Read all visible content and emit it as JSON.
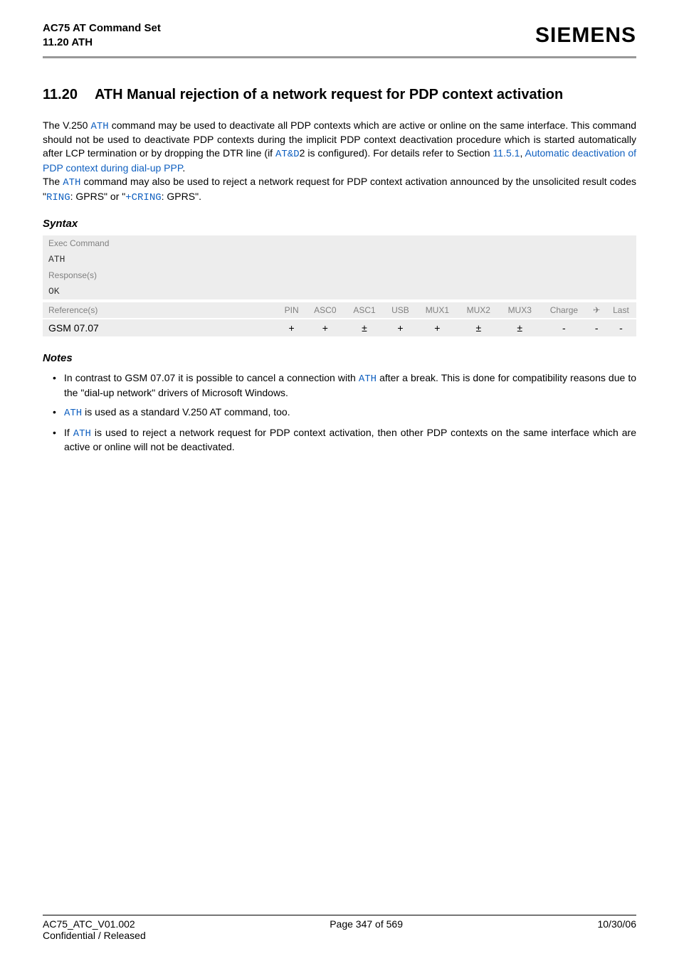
{
  "header": {
    "line1": "AC75 AT Command Set",
    "line2": "11.20 ATH",
    "logo": "SIEMENS"
  },
  "section": {
    "number": "11.20",
    "title": "ATH   Manual rejection of a network request for PDP context activation"
  },
  "paragraph": {
    "p1a": "The V.250 ",
    "p1b": "ATH",
    "p1c": " command may be used to deactivate all PDP contexts which are active or online on the same interface. This command should not be used to deactivate PDP contexts during the implicit PDP context deactivation procedure which is started automatically after LCP termination or by dropping the DTR line (if ",
    "p1d": "AT&D",
    "p1e": "2 is configured). For details refer to Section ",
    "p1f": "11.5.1",
    "p1g": ", ",
    "p1h": "Automatic deactivation of PDP context during dial-up PPP",
    "p1i": ".",
    "p2a": "The ",
    "p2b": "ATH",
    "p2c": " command may also be used to reject a network request for PDP context activation announced by the unsolicited result codes \"",
    "p2d": "RING",
    "p2e": ": GPRS\" or \"",
    "p2f": "+CRING",
    "p2g": ": GPRS\"."
  },
  "syntax": {
    "heading": "Syntax",
    "execLabel": "Exec Command",
    "execCmd": "ATH",
    "respLabel": "Response(s)",
    "respVal": "OK",
    "ref": {
      "label": "Reference(s)",
      "cols": [
        "PIN",
        "ASC0",
        "ASC1",
        "USB",
        "MUX1",
        "MUX2",
        "MUX3",
        "Charge",
        "",
        "Last"
      ],
      "airplane": "✈",
      "rowName": "GSM 07.07",
      "vals": [
        "+",
        "+",
        "±",
        "+",
        "+",
        "±",
        "±",
        "-",
        "-",
        "-"
      ]
    }
  },
  "notes": {
    "heading": "Notes",
    "n1a": "In contrast to GSM 07.07 it is possible to cancel a connection with ",
    "n1b": "ATH",
    "n1c": " after a break. This is done for compatibility reasons due to the \"dial-up network\" drivers of Microsoft Windows.",
    "n2a": "ATH",
    "n2b": " is used as a standard V.250 AT command, too.",
    "n3a": "If ",
    "n3b": "ATH",
    "n3c": " is used to reject a network request for PDP context activation, then other PDP contexts on the same interface which are active or online will not be deactivated."
  },
  "footer": {
    "left1": "AC75_ATC_V01.002",
    "center": "Page 347 of 569",
    "right": "10/30/06",
    "left2": "Confidential / Released"
  }
}
